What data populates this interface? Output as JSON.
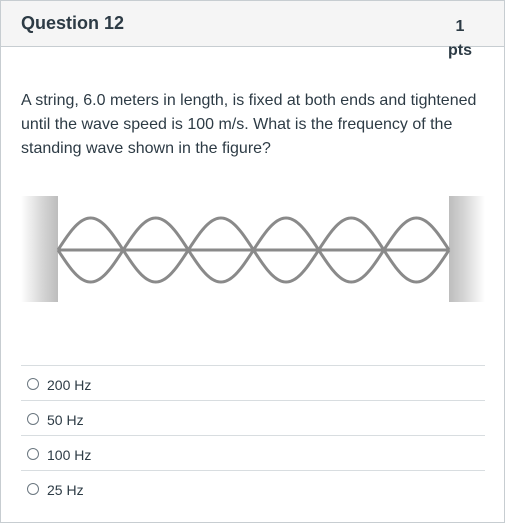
{
  "question": {
    "title": "Question 12",
    "points_value": "1",
    "points_unit": "pts",
    "text": "A string, 6.0 meters in length, is fixed at both ends and tightened until the wave speed is 100 m/s. What is the frequency of the standing wave shown in the figure?"
  },
  "figure": {
    "loops": 6,
    "wave_color": "#8a8a8a",
    "wall_color": "#d0d0d0"
  },
  "answers": [
    {
      "label": "200 Hz"
    },
    {
      "label": "50 Hz"
    },
    {
      "label": "100 Hz"
    },
    {
      "label": "25 Hz"
    }
  ]
}
